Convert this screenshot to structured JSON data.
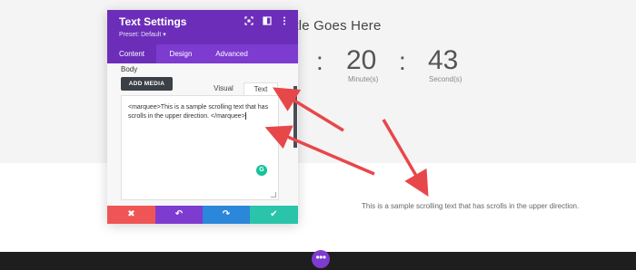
{
  "page": {
    "title": "Title Goes Here",
    "countdown": [
      {
        "number": "20",
        "label": "Minute(s)"
      },
      {
        "number": "43",
        "label": "Second(s)"
      }
    ],
    "separator": ":",
    "scrolling_text": "This is a sample scrolling text that has scrolls in the upper direction.",
    "dots_label": "•••"
  },
  "modal": {
    "title": "Text Settings",
    "preset": "Preset: Default ▾",
    "header_icons": [
      "fullscreen-icon",
      "split-view-icon",
      "more-options-icon"
    ],
    "tabs": [
      "Content",
      "Design",
      "Advanced"
    ],
    "active_tab": "Content",
    "body_label": "Body",
    "add_media_label": "ADD MEDIA",
    "editor_tabs": [
      "Visual",
      "Text"
    ],
    "active_editor_tab": "Text",
    "editor_content": "<marquee>This is a sample scrolling text that has scrolls in the upper direction. </marquee>",
    "grammarly_label": "G"
  },
  "footer": {
    "buttons": [
      {
        "name": "cancel",
        "icon": "✖",
        "color": "#ef5555"
      },
      {
        "name": "undo",
        "icon": "↶",
        "color": "#7e3bd0"
      },
      {
        "name": "redo",
        "icon": "↷",
        "color": "#2b87da"
      },
      {
        "name": "save",
        "icon": "✔",
        "color": "#29c4a9"
      }
    ]
  },
  "colors": {
    "header": "#6c2eb9",
    "tabs": "#7e3bd0",
    "arrow": "#e8474a"
  }
}
